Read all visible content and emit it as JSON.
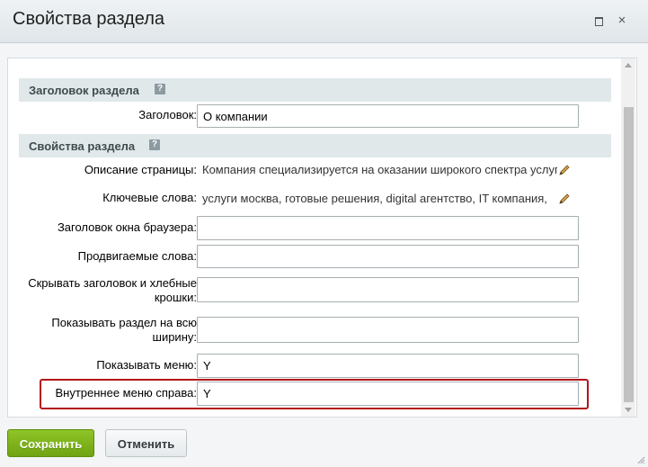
{
  "window": {
    "title": "Свойства раздела",
    "maximize_icon": "maximize-icon",
    "close_icon": "close-icon",
    "close_glyph": "×"
  },
  "sections": [
    {
      "title": "Заголовок раздела",
      "help": "?"
    },
    {
      "title": "Свойства раздела",
      "help": "?"
    }
  ],
  "fields": {
    "heading": {
      "label": "Заголовок:",
      "value": "О компании"
    },
    "page_description": {
      "label": "Описание страницы:",
      "value": "Компания специализируется на оказании широкого спектра услуг"
    },
    "keywords": {
      "label": "Ключевые слова:",
      "value": "услуги москва, готовые решения, digital агентство, IT компания,"
    },
    "browser_title": {
      "label": "Заголовок окна браузера:",
      "value": ""
    },
    "promoted_words": {
      "label": "Продвигаемые слова:",
      "value": ""
    },
    "hide_title_breadcrumbs": {
      "label_line1": "Скрывать заголовок и хлебные",
      "label_line2": "крошки:",
      "value": ""
    },
    "full_width": {
      "label_line1": "Показывать раздел на всю",
      "label_line2": "ширину:",
      "value": ""
    },
    "show_menu": {
      "label": "Показывать меню:",
      "value": "Y"
    },
    "inner_menu_right": {
      "label": "Внутреннее меню справа:",
      "value": "Y"
    }
  },
  "buttons": {
    "save": "Сохранить",
    "cancel": "Отменить"
  },
  "colors": {
    "accent_green": "#7bb41b",
    "highlight_red": "#b3131b",
    "section_bg": "#e0e8ea"
  }
}
